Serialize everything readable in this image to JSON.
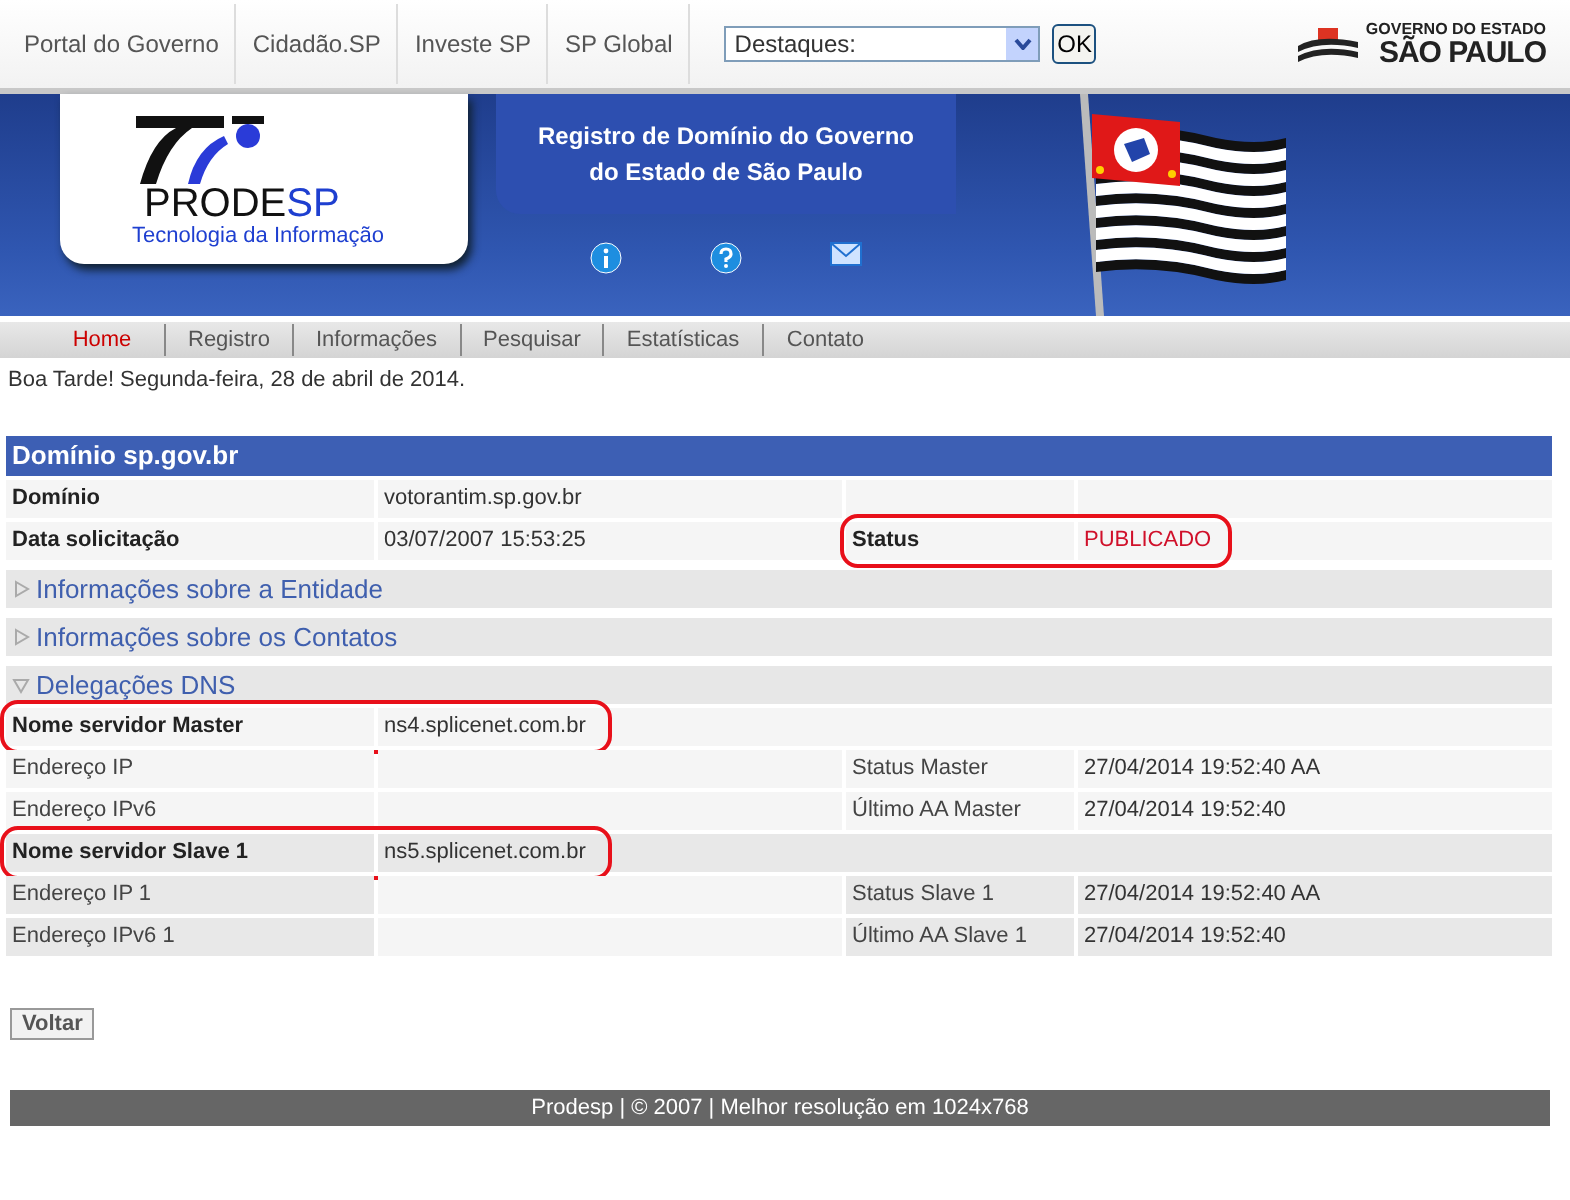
{
  "top_links": [
    "Portal do Governo",
    "Cidadão.SP",
    "Investe SP",
    "SP Global"
  ],
  "highlights_select": {
    "value": "Destaques:"
  },
  "ok_button": "OK",
  "gov_logo": {
    "line_1": "GOVERNO DO ESTADO",
    "line_2": "SÃO PAULO"
  },
  "banner": {
    "logo_name_1": "PRODE",
    "logo_name_2": "SP",
    "logo_tagline": "Tecnologia da Informação",
    "title_1": "Registro de Domínio do Governo",
    "title_2": "do Estado de São Paulo"
  },
  "nav": [
    {
      "label": "Home",
      "selected": true
    },
    {
      "label": "Registro",
      "selected": false
    },
    {
      "label": "Informações",
      "selected": false
    },
    {
      "label": "Pesquisar",
      "selected": false
    },
    {
      "label": "Estatísticas",
      "selected": false
    },
    {
      "label": "Contato",
      "selected": false
    }
  ],
  "greeting": "Boa Tarde! Segunda-feira, 28 de abril de 2014.",
  "panel_title": "Domínio sp.gov.br",
  "domain_rows": [
    {
      "label": "Domínio",
      "value": "votorantim.sp.gov.br"
    },
    {
      "label": "Data solicitação",
      "value": "03/07/2007 15:53:25",
      "label_2": "Status",
      "value_2": "PUBLICADO",
      "circled": true
    }
  ],
  "sections": [
    {
      "title": "Informações sobre a Entidade",
      "expanded": false
    },
    {
      "title": "Informações sobre os Contatos",
      "expanded": false
    },
    {
      "title": "Delegações DNS",
      "expanded": true
    }
  ],
  "dns_rows": [
    {
      "kind": "server",
      "label": "Nome servidor Master",
      "value": "ns4.splicenet.com.br",
      "circled": true
    },
    {
      "kind": "detail",
      "label": "Endereço IP",
      "label_2": "Status Master",
      "value_2": "27/04/2014 19:52:40 AA"
    },
    {
      "kind": "detail",
      "label": "Endereço IPv6",
      "label_2": "Último AA Master",
      "value_2": "27/04/2014 19:52:40"
    },
    {
      "kind": "server",
      "label": "Nome servidor Slave 1",
      "value": "ns5.splicenet.com.br",
      "circled": true
    },
    {
      "kind": "detail",
      "label": "Endereço IP 1",
      "label_2": "Status Slave 1",
      "value_2": "27/04/2014 19:52:40 AA"
    },
    {
      "kind": "detail",
      "label": "Endereço IPv6 1",
      "label_2": "Último AA Slave 1",
      "value_2": "27/04/2014 19:52:40"
    }
  ],
  "back_button": "Voltar",
  "footer": "Prodesp | © 2007 | Melhor resolução em 1024x768"
}
